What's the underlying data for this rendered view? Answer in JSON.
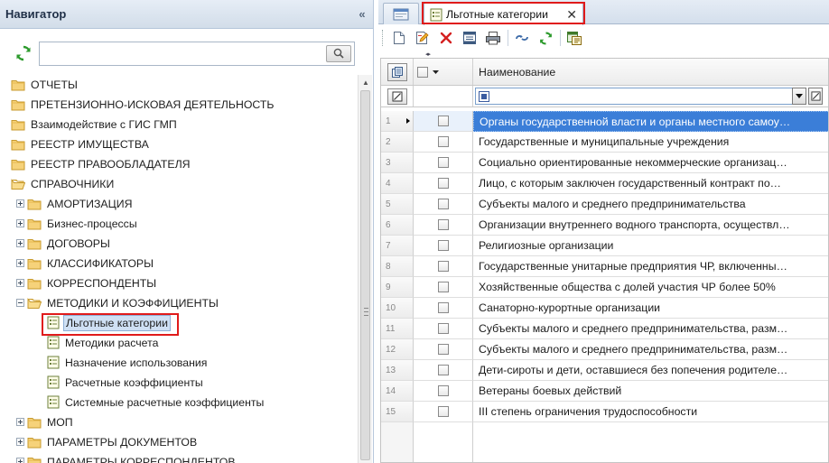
{
  "navigator": {
    "title": "Навигатор",
    "collapse_glyph": "«",
    "search": {
      "value": "",
      "placeholder": ""
    },
    "tree": [
      {
        "label": "ОТЧЕТЫ",
        "level": 0,
        "kind": "folder"
      },
      {
        "label": "ПРЕТЕНЗИОННО-ИСКОВАЯ ДЕЯТЕЛЬНОСТЬ",
        "level": 0,
        "kind": "folder"
      },
      {
        "label": "Взаимодействие с ГИС ГМП",
        "level": 0,
        "kind": "folder"
      },
      {
        "label": "РЕЕСТР ИМУЩЕСТВА",
        "level": 0,
        "kind": "folder"
      },
      {
        "label": "РЕЕСТР ПРАВООБЛАДАТЕЛЯ",
        "level": 0,
        "kind": "folder"
      },
      {
        "label": "СПРАВОЧНИКИ",
        "level": 0,
        "kind": "folder-open"
      },
      {
        "label": "АМОРТИЗАЦИЯ",
        "level": 1,
        "kind": "folder",
        "expander": "plus"
      },
      {
        "label": "Бизнес-процессы",
        "level": 1,
        "kind": "folder",
        "expander": "plus"
      },
      {
        "label": "ДОГОВОРЫ",
        "level": 1,
        "kind": "folder",
        "expander": "plus"
      },
      {
        "label": "КЛАССИФИКАТОРЫ",
        "level": 1,
        "kind": "folder",
        "expander": "plus"
      },
      {
        "label": "КОРРЕСПОНДЕНТЫ",
        "level": 1,
        "kind": "folder",
        "expander": "plus"
      },
      {
        "label": "МЕТОДИКИ И КОЭФФИЦИЕНТЫ",
        "level": 1,
        "kind": "folder-open",
        "expander": "minus"
      },
      {
        "label": "Льготные категории",
        "level": 2,
        "kind": "doc",
        "selected": true
      },
      {
        "label": "Методики расчета",
        "level": 2,
        "kind": "doc"
      },
      {
        "label": "Назначение использования",
        "level": 2,
        "kind": "doc"
      },
      {
        "label": "Расчетные коэффициенты",
        "level": 2,
        "kind": "doc"
      },
      {
        "label": "Системные расчетные коэффициенты",
        "level": 2,
        "kind": "doc"
      },
      {
        "label": "МОП",
        "level": 1,
        "kind": "folder",
        "expander": "plus"
      },
      {
        "label": "ПАРАМЕТРЫ ДОКУМЕНТОВ",
        "level": 1,
        "kind": "folder",
        "expander": "plus"
      },
      {
        "label": "ПАРАМЕТРЫ КОРРЕСПОНДЕНТОВ",
        "level": 1,
        "kind": "folder",
        "expander": "plus"
      }
    ]
  },
  "tabs": {
    "active_label": "Льготные категории",
    "close_glyph": "✕"
  },
  "toolbar": {
    "buttons": [
      "new-document-icon",
      "edit-document-icon",
      "delete-icon",
      "select-columns-icon",
      "print-icon",
      "link-icon",
      "refresh-icon",
      "export-icon"
    ]
  },
  "grid": {
    "column_name": "Наименование",
    "splitter_glyph": "◂▸",
    "rows": [
      {
        "num": "1",
        "name": "Органы государственной власти и органы местного самоу…",
        "current": true
      },
      {
        "num": "2",
        "name": "Государственные и муниципальные учреждения"
      },
      {
        "num": "3",
        "name": "Социально ориентированные некоммерческие организац…"
      },
      {
        "num": "4",
        "name": "Лицо, с которым заключен государственный контракт по…"
      },
      {
        "num": "5",
        "name": "Субъекты малого и среднего предпринимательства"
      },
      {
        "num": "6",
        "name": "Организации внутреннего водного транспорта, осуществл…"
      },
      {
        "num": "7",
        "name": "Религиозные организации"
      },
      {
        "num": "8",
        "name": "Государственные унитарные предприятия ЧР, включенны…"
      },
      {
        "num": "9",
        "name": "Хозяйственные общества с долей участия ЧР более 50%"
      },
      {
        "num": "10",
        "name": "Санаторно-курортные организации"
      },
      {
        "num": "11",
        "name": "Субъекты малого и среднего предпринимательства, разм…"
      },
      {
        "num": "12",
        "name": "Субъекты малого и среднего предпринимательства, разм…"
      },
      {
        "num": "13",
        "name": "Дети-сироты и дети, оставшиеся без попечения родителе…"
      },
      {
        "num": "14",
        "name": "Ветераны боевых действий"
      },
      {
        "num": "15",
        "name": "III степень ограничения трудоспособности"
      }
    ]
  },
  "colors": {
    "highlight_frame": "#e01b1b",
    "selection": "#3b7ed8",
    "header_gradient_top": "#e6edf6"
  }
}
